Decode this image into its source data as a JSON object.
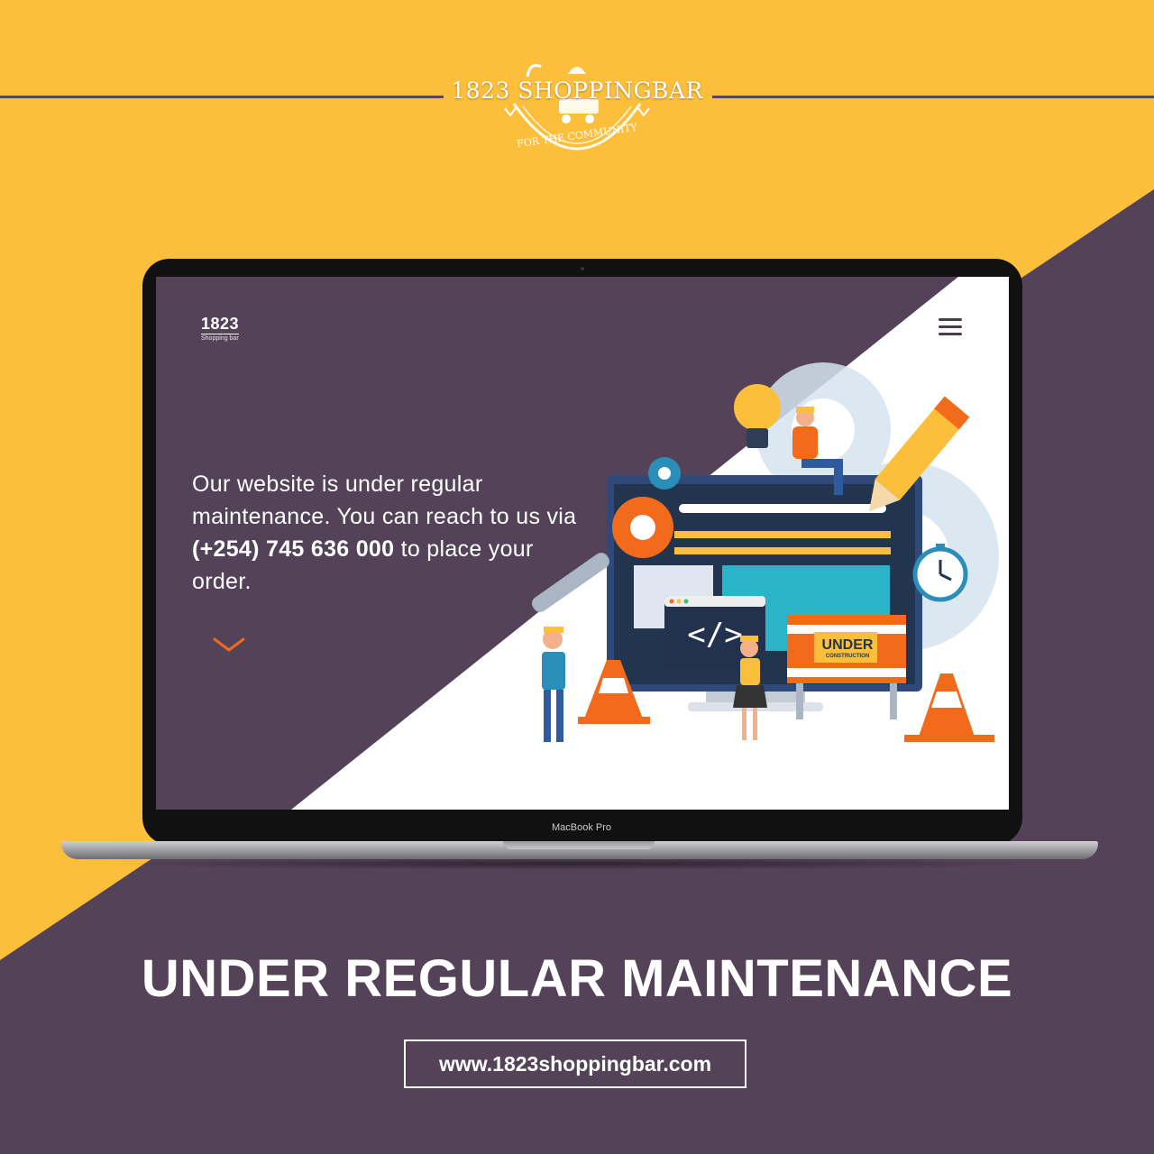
{
  "brand": {
    "logo_text": "1823 SHOPPINGBAR",
    "logo_tagline": "FOR THE COMMUNITY"
  },
  "colors": {
    "yellow": "#fcbf3c",
    "purple": "#544259",
    "white": "#ffffff",
    "accent_orange": "#f26b1d"
  },
  "screen": {
    "mini_logo_number": "1823",
    "mini_logo_sub": "Shopping bar",
    "menu_icon": "hamburger-menu-icon",
    "message_part1": "Our  website is under regular maintenance. You can reach to us via ",
    "phone": "(+254) 745 636 000",
    "message_part2": " to place your order.",
    "scroll_icon": "chevron-down-icon",
    "sign_text": "UNDER",
    "sign_subtext": "CONSTRUCTION"
  },
  "device_label": "MacBook Pro",
  "headline": "UNDER REGULAR MAINTENANCE",
  "website_url": "www.1823shoppingbar.com"
}
